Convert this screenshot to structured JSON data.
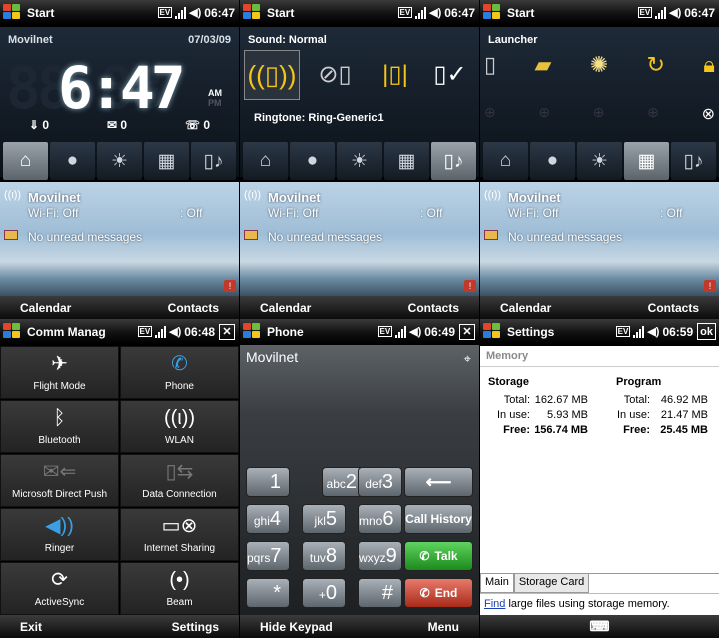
{
  "status": {
    "ev": "EV",
    "time_a": "06:47",
    "time_b": "06:48",
    "time_c": "06:49",
    "time_d": "06:59"
  },
  "start_label": "Start",
  "panel1": {
    "carrier": "Movilnet",
    "date": "07/03/09",
    "ghost_digits": "88:88",
    "time_digits": "6:47",
    "am": "AM",
    "pm": "PM",
    "counts": [
      "0",
      "0",
      "0"
    ]
  },
  "panel2": {
    "header": "Sound: Normal",
    "ringtone": "Ringtone: Ring-Generic1"
  },
  "panel3": {
    "header": "Launcher"
  },
  "today": {
    "carrier": "Movilnet",
    "wifi": "Wi-Fi: Off",
    "bt": ": Off",
    "messages": "No unread messages"
  },
  "softkeys_today": {
    "left": "Calendar",
    "right": "Contacts"
  },
  "comm": {
    "title": "Comm Manag",
    "items": [
      {
        "label": "Flight Mode",
        "color": "#ffffff"
      },
      {
        "label": "Phone",
        "color": "#3aa0e6"
      },
      {
        "label": "Bluetooth",
        "color": "#ffffff"
      },
      {
        "label": "WLAN",
        "color": "#ffffff"
      },
      {
        "label": "Microsoft Direct Push",
        "color": "#777777"
      },
      {
        "label": "Data Connection",
        "color": "#777777"
      },
      {
        "label": "Ringer",
        "color": "#3aa0e6"
      },
      {
        "label": "Internet Sharing",
        "color": "#ffffff"
      },
      {
        "label": "ActiveSync",
        "color": "#ffffff"
      },
      {
        "label": "Beam",
        "color": "#ffffff"
      }
    ],
    "softkeys": {
      "left": "Exit",
      "right": "Settings"
    }
  },
  "phone": {
    "title": "Phone",
    "carrier": "Movilnet",
    "keys": [
      {
        "num": "1",
        "sub": ""
      },
      {
        "num": "2",
        "sub": "abc"
      },
      {
        "num": "3",
        "sub": "def"
      },
      {
        "num": "4",
        "sub": "ghi"
      },
      {
        "num": "5",
        "sub": "jkl"
      },
      {
        "num": "6",
        "sub": "mno"
      },
      {
        "num": "7",
        "sub": "pqrs"
      },
      {
        "num": "8",
        "sub": "tuv"
      },
      {
        "num": "9",
        "sub": "wxyz"
      },
      {
        "num": "*",
        "sub": ""
      },
      {
        "num": "0",
        "sub": "+"
      },
      {
        "num": "#",
        "sub": ""
      }
    ],
    "call_history": "Call History",
    "talk": "Talk",
    "end": "End",
    "softkeys": {
      "left": "Hide Keypad",
      "right": "Menu"
    }
  },
  "settings": {
    "title": "Settings",
    "ok": "ok",
    "section": "Memory",
    "storage": {
      "title": "Storage",
      "total_label": "Total:",
      "total": "162.67 MB",
      "inuse_label": "In use:",
      "inuse": "5.93 MB",
      "free_label": "Free:",
      "free": "156.74 MB"
    },
    "program": {
      "title": "Program",
      "total_label": "Total:",
      "total": "46.92 MB",
      "inuse_label": "In use:",
      "inuse": "21.47 MB",
      "free_label": "Free:",
      "free": "25.45 MB"
    },
    "tabs": [
      "Main",
      "Storage Card"
    ],
    "find_link": "Find",
    "find_text": " large files using storage memory."
  }
}
